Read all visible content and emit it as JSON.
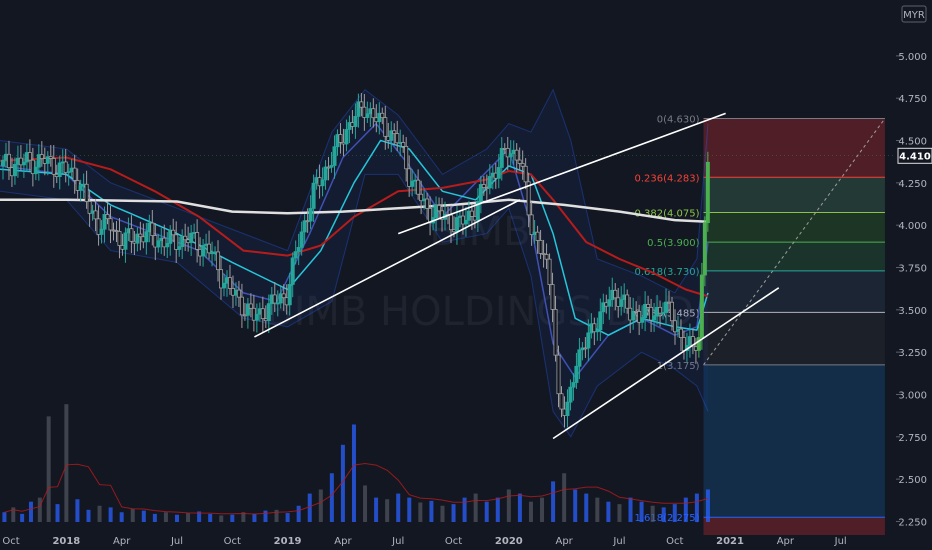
{
  "currency_label": "MYR",
  "watermark": "BIMB HOLDINGS BHD",
  "watermark_symbol": "BIMB",
  "last_price_label": "4.410",
  "last_price": 4.41,
  "colors": {
    "background": "#131722",
    "up": "#26a69a",
    "up_bright": "#4caf50",
    "down": "#ef5350",
    "neutral": "#9e9e9e",
    "ma_red": "#b71c1c",
    "ma_white": "#e0e0e0",
    "ma_teal": "#26c6da",
    "ma_blue": "#3f51b5",
    "bb_band": "#2962ff",
    "volume_up": "#2962ff",
    "volume_down": "#5d606b",
    "trendline": "#ffffff"
  },
  "chart_data": {
    "type": "line",
    "title": "",
    "xlabel": "",
    "ylabel": "",
    "ylim": [
      2.17,
      5.33
    ],
    "y_ticks": [
      "5.000",
      "4.750",
      "4.500",
      "4.250",
      "4.000",
      "3.750",
      "3.500",
      "3.250",
      "3.000",
      "2.750",
      "2.500",
      "2.250"
    ],
    "y_tick_values": [
      5.0,
      4.75,
      4.5,
      4.25,
      4.0,
      3.75,
      3.5,
      3.25,
      3.0,
      2.75,
      2.5,
      2.25
    ],
    "x_ticks": [
      "Oct",
      "2018",
      "Apr",
      "Jul",
      "Oct",
      "2019",
      "Apr",
      "Jul",
      "Oct",
      "2020",
      "Apr",
      "Jul",
      "Oct",
      "2021",
      "Apr",
      "Jul"
    ],
    "x_tick_positions": [
      2017.75,
      2018.0,
      2018.25,
      2018.5,
      2018.75,
      2019.0,
      2019.25,
      2019.5,
      2019.75,
      2020.0,
      2020.25,
      2020.5,
      2020.75,
      2021.0,
      2021.25,
      2021.5
    ],
    "xlim": [
      2017.7,
      2021.75
    ],
    "grid": false,
    "series": [
      {
        "key": "price",
        "x": [
          2017.7,
          2017.8,
          2017.9,
          2018.0,
          2018.05,
          2018.1,
          2018.15,
          2018.2,
          2018.25,
          2018.35,
          2018.45,
          2018.55,
          2018.65,
          2018.7,
          2018.75,
          2018.85,
          2018.9,
          2018.95,
          2019.0,
          2019.05,
          2019.12,
          2019.2,
          2019.28,
          2019.35,
          2019.42,
          2019.5,
          2019.55,
          2019.62,
          2019.7,
          2019.78,
          2019.85,
          2019.9,
          2019.95,
          2020.0,
          2020.05,
          2020.1,
          2020.15,
          2020.2,
          2020.22,
          2020.26,
          2020.3,
          2020.35,
          2020.4,
          2020.45,
          2020.5,
          2020.55,
          2020.6,
          2020.65,
          2020.7,
          2020.75,
          2020.8,
          2020.83,
          2020.86,
          2020.88,
          2020.9
        ],
        "values": [
          4.35,
          4.37,
          4.38,
          4.32,
          4.28,
          4.1,
          4.0,
          4.0,
          3.9,
          3.95,
          3.9,
          3.92,
          3.85,
          3.7,
          3.6,
          3.45,
          3.5,
          3.55,
          3.6,
          3.9,
          4.2,
          4.4,
          4.6,
          4.7,
          4.6,
          4.5,
          4.3,
          4.1,
          4.05,
          4.0,
          4.1,
          4.25,
          4.35,
          4.45,
          4.4,
          4.0,
          3.85,
          3.55,
          3.0,
          2.85,
          3.2,
          3.3,
          3.45,
          3.55,
          3.6,
          3.45,
          3.5,
          3.45,
          3.55,
          3.4,
          3.3,
          3.25,
          3.35,
          3.9,
          4.41
        ]
      },
      {
        "key": "ema200",
        "name": "",
        "x": [
          2017.7,
          2018.0,
          2018.5,
          2018.75,
          2019.0,
          2019.25,
          2019.5,
          2019.75,
          2020.0,
          2020.25,
          2020.5,
          2020.75,
          2020.9
        ],
        "values": [
          4.15,
          4.15,
          4.14,
          4.08,
          4.07,
          4.08,
          4.1,
          4.12,
          4.15,
          4.12,
          4.08,
          4.03,
          4.02
        ]
      },
      {
        "key": "ma100",
        "name": "",
        "x": [
          2017.7,
          2018.0,
          2018.2,
          2018.4,
          2018.6,
          2018.8,
          2019.0,
          2019.15,
          2019.3,
          2019.5,
          2019.7,
          2019.9,
          2020.0,
          2020.1,
          2020.2,
          2020.35,
          2020.5,
          2020.65,
          2020.8,
          2020.9
        ],
        "values": [
          4.38,
          4.4,
          4.33,
          4.2,
          4.05,
          3.85,
          3.82,
          3.88,
          4.05,
          4.2,
          4.22,
          4.27,
          4.32,
          4.3,
          4.15,
          3.9,
          3.8,
          3.72,
          3.62,
          3.58
        ]
      },
      {
        "key": "ma50",
        "name": "",
        "x": [
          2017.7,
          2018.0,
          2018.2,
          2018.5,
          2018.75,
          2019.0,
          2019.15,
          2019.3,
          2019.42,
          2019.55,
          2019.7,
          2019.85,
          2020.0,
          2020.1,
          2020.2,
          2020.3,
          2020.45,
          2020.6,
          2020.75,
          2020.85,
          2020.9
        ],
        "values": [
          4.33,
          4.3,
          4.12,
          3.95,
          3.78,
          3.62,
          3.85,
          4.25,
          4.5,
          4.45,
          4.2,
          4.15,
          4.35,
          4.3,
          3.95,
          3.45,
          3.35,
          3.45,
          3.4,
          3.38,
          3.6
        ]
      },
      {
        "key": "ma20",
        "name": "",
        "x": [
          2017.7,
          2018.0,
          2018.2,
          2018.4,
          2018.6,
          2018.8,
          2018.95,
          2019.1,
          2019.25,
          2019.4,
          2019.55,
          2019.7,
          2019.85,
          2020.0,
          2020.1,
          2020.2,
          2020.3,
          2020.45,
          2020.6,
          2020.75,
          2020.85,
          2020.9
        ],
        "values": [
          4.35,
          4.3,
          4.05,
          3.95,
          3.85,
          3.6,
          3.55,
          3.95,
          4.4,
          4.6,
          4.35,
          4.05,
          4.25,
          4.45,
          4.0,
          3.3,
          3.1,
          3.35,
          3.45,
          3.35,
          3.4,
          3.9
        ]
      },
      {
        "key": "bb_upper",
        "name": "",
        "x": [
          2017.7,
          2018.0,
          2018.2,
          2018.5,
          2018.8,
          2019.0,
          2019.2,
          2019.35,
          2019.5,
          2019.7,
          2019.9,
          2020.0,
          2020.1,
          2020.2,
          2020.28,
          2020.4,
          2020.6,
          2020.75,
          2020.85,
          2020.9
        ],
        "values": [
          4.5,
          4.45,
          4.25,
          4.1,
          3.95,
          3.85,
          4.55,
          4.8,
          4.65,
          4.3,
          4.45,
          4.6,
          4.55,
          4.8,
          4.5,
          3.8,
          3.7,
          3.6,
          3.8,
          4.6
        ]
      },
      {
        "key": "bb_lower",
        "name": "",
        "x": [
          2017.7,
          2018.0,
          2018.2,
          2018.5,
          2018.8,
          2019.0,
          2019.2,
          2019.35,
          2019.5,
          2019.7,
          2019.9,
          2020.0,
          2020.1,
          2020.2,
          2020.28,
          2020.4,
          2020.6,
          2020.75,
          2020.85,
          2020.9
        ],
        "values": [
          4.2,
          4.15,
          3.85,
          3.78,
          3.45,
          3.4,
          3.55,
          4.3,
          4.3,
          3.9,
          3.95,
          4.1,
          3.7,
          2.9,
          2.75,
          3.05,
          3.25,
          3.15,
          3.05,
          2.9
        ]
      }
    ],
    "volume": {
      "x": [
        2017.72,
        2017.76,
        2017.8,
        2017.84,
        2017.88,
        2017.92,
        2017.96,
        2018.0,
        2018.05,
        2018.1,
        2018.15,
        2018.2,
        2018.25,
        2018.3,
        2018.35,
        2018.4,
        2018.45,
        2018.5,
        2018.55,
        2018.6,
        2018.65,
        2018.7,
        2018.75,
        2018.8,
        2018.85,
        2018.9,
        2018.95,
        2019.0,
        2019.05,
        2019.1,
        2019.15,
        2019.2,
        2019.25,
        2019.3,
        2019.35,
        2019.4,
        2019.45,
        2019.5,
        2019.55,
        2019.6,
        2019.65,
        2019.7,
        2019.75,
        2019.8,
        2019.85,
        2019.9,
        2019.95,
        2020.0,
        2020.05,
        2020.1,
        2020.15,
        2020.2,
        2020.25,
        2020.3,
        2020.35,
        2020.4,
        2020.45,
        2020.5,
        2020.55,
        2020.6,
        2020.65,
        2020.7,
        2020.75,
        2020.8,
        2020.85,
        2020.9
      ],
      "values": [
        12,
        18,
        10,
        25,
        30,
        130,
        22,
        145,
        28,
        15,
        20,
        18,
        12,
        16,
        14,
        10,
        12,
        9,
        11,
        13,
        10,
        8,
        9,
        12,
        10,
        14,
        15,
        11,
        20,
        35,
        40,
        60,
        95,
        120,
        45,
        30,
        28,
        35,
        30,
        24,
        26,
        20,
        22,
        30,
        35,
        25,
        30,
        40,
        35,
        25,
        30,
        50,
        60,
        40,
        35,
        30,
        25,
        22,
        30,
        25,
        20,
        18,
        22,
        30,
        35,
        40
      ],
      "up": [
        true,
        false,
        true,
        true,
        false,
        false,
        true,
        false,
        true,
        true,
        false,
        true,
        true,
        false,
        true,
        true,
        false,
        true,
        false,
        true,
        true,
        false,
        true,
        false,
        true,
        true,
        false,
        true,
        true,
        true,
        false,
        true,
        true,
        true,
        false,
        true,
        false,
        true,
        true,
        false,
        true,
        false,
        true,
        true,
        false,
        true,
        true,
        false,
        true,
        false,
        false,
        true,
        false,
        true,
        true,
        false,
        true,
        false,
        true,
        true,
        false,
        true,
        true,
        true,
        true,
        true
      ],
      "max": 160
    }
  },
  "trendlines": [
    {
      "name": "trendline-lower-2019",
      "x1": 2018.85,
      "y1": 3.34,
      "x2": 2020.05,
      "y2": 4.15
    },
    {
      "name": "trendline-upper-2019",
      "x1": 2019.5,
      "y1": 3.95,
      "x2": 2020.98,
      "y2": 4.66
    },
    {
      "name": "trendline-channel-2020",
      "x1": 2020.2,
      "y1": 2.74,
      "x2": 2021.22,
      "y2": 3.63
    }
  ],
  "fib": {
    "levels": [
      {
        "ratio": "0",
        "label": "0(4.630)",
        "value": 4.63,
        "color": "#787b86",
        "fill": "#5c2027"
      },
      {
        "ratio": "0.236",
        "label": "0.236(4.283)",
        "value": 4.283,
        "color": "#f44336",
        "fill": "#27403a"
      },
      {
        "ratio": "0.382",
        "label": "0.382(4.075)",
        "value": 4.075,
        "color": "#8bc34a",
        "fill": "#1f3b25"
      },
      {
        "ratio": "0.5",
        "label": "0.5(3.900)",
        "value": 3.9,
        "color": "#4caf50",
        "fill": "#1c3a2e"
      },
      {
        "ratio": "0.618",
        "label": "0.618(3.730)",
        "value": 3.73,
        "color": "#26a69a",
        "fill": "#1e2836"
      },
      {
        "ratio": "0.786",
        "label": "0.786(3.485)",
        "value": 3.485,
        "color": "#b2b5be",
        "fill": "#1f2229"
      },
      {
        "ratio": "1",
        "label": "1(3.175)",
        "value": 3.175,
        "color": "#787b86",
        "fill": "#14304d"
      },
      {
        "ratio": "1.618",
        "label": "1.618(2.275)",
        "value": 2.275,
        "color": "#2962ff",
        "fill": "#5c2027"
      }
    ],
    "bottom_value": 2.17,
    "x_start": 2020.88,
    "x_end": 2021.7
  }
}
